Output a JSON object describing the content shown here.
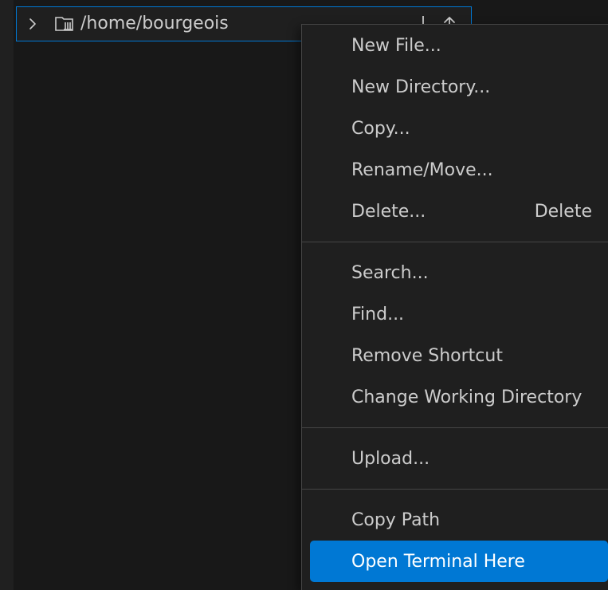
{
  "explorer": {
    "path_label": "/home/bourgeois",
    "chevron_icon": "chevron-right-icon",
    "folder_icon": "home-folder-icon",
    "action_icons": [
      "collapse-icon",
      "upload-arrow-icon"
    ]
  },
  "context_menu": {
    "groups": [
      [
        {
          "label": "New File...",
          "shortcut": ""
        },
        {
          "label": "New Directory...",
          "shortcut": ""
        },
        {
          "label": "Copy...",
          "shortcut": ""
        },
        {
          "label": "Rename/Move...",
          "shortcut": ""
        },
        {
          "label": "Delete...",
          "shortcut": "Delete"
        }
      ],
      [
        {
          "label": "Search...",
          "shortcut": ""
        },
        {
          "label": "Find...",
          "shortcut": ""
        },
        {
          "label": "Remove Shortcut",
          "shortcut": ""
        },
        {
          "label": "Change Working Directory",
          "shortcut": ""
        }
      ],
      [
        {
          "label": "Upload...",
          "shortcut": ""
        }
      ],
      [
        {
          "label": "Copy Path",
          "shortcut": ""
        },
        {
          "label": "Open Terminal Here",
          "shortcut": "",
          "active": true
        }
      ]
    ]
  },
  "colors": {
    "background": "#181818",
    "menu_background": "#1f1f1f",
    "accent": "#0078d4",
    "text": "#cccccc"
  }
}
